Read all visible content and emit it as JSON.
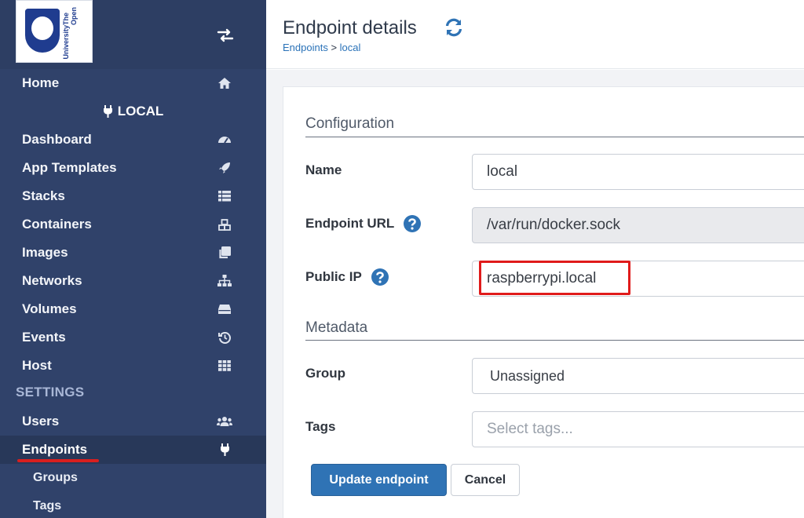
{
  "brand": {
    "logo_line1": "The Open",
    "logo_line2": "University"
  },
  "sidebar": {
    "home_label": "Home",
    "endpoint_name": "LOCAL",
    "items": [
      {
        "label": "Dashboard",
        "icon": "tachometer-icon"
      },
      {
        "label": "App Templates",
        "icon": "rocket-icon"
      },
      {
        "label": "Stacks",
        "icon": "list-icon"
      },
      {
        "label": "Containers",
        "icon": "cubes-icon"
      },
      {
        "label": "Images",
        "icon": "clone-icon"
      },
      {
        "label": "Networks",
        "icon": "sitemap-icon"
      },
      {
        "label": "Volumes",
        "icon": "hdd-icon"
      },
      {
        "label": "Events",
        "icon": "history-icon"
      },
      {
        "label": "Host",
        "icon": "th-icon"
      }
    ],
    "settings_heading": "SETTINGS",
    "settings_items": [
      {
        "label": "Users",
        "icon": "users-icon"
      },
      {
        "label": "Endpoints",
        "icon": "plug-icon",
        "active": true
      },
      {
        "label": "Groups",
        "sub": true
      },
      {
        "label": "Tags",
        "sub": true
      }
    ]
  },
  "header": {
    "title": "Endpoint details",
    "breadcrumb_parent": "Endpoints",
    "breadcrumb_separator": " > ",
    "breadcrumb_current": "local"
  },
  "form": {
    "configuration_title": "Configuration",
    "name_label": "Name",
    "name_value": "local",
    "url_label": "Endpoint URL",
    "url_value": "/var/run/docker.sock",
    "public_ip_label": "Public IP",
    "public_ip_value": "raspberrypi.local",
    "metadata_title": "Metadata",
    "group_label": "Group",
    "group_value": "Unassigned",
    "tags_label": "Tags",
    "tags_placeholder": "Select tags...",
    "update_button": "Update endpoint",
    "cancel_button": "Cancel"
  },
  "colors": {
    "sidebar_bg": "#30426a",
    "primary": "#2f73b5",
    "highlight": "#e01b1b"
  }
}
